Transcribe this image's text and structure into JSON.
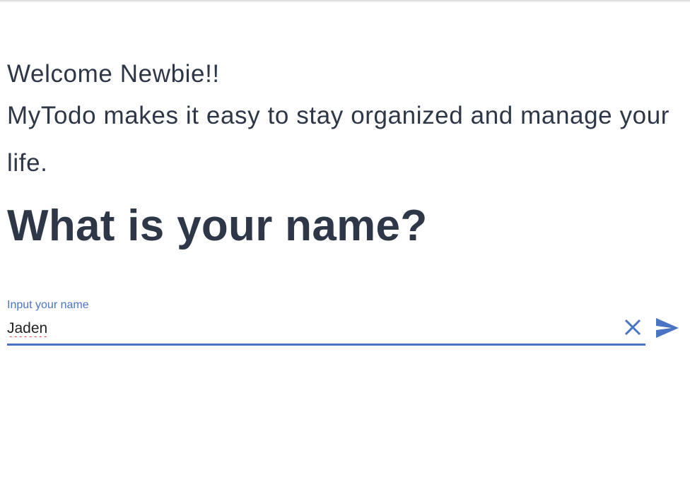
{
  "welcome": {
    "greeting": "Welcome Newbie!!",
    "tagline": "MyTodo makes it easy to stay organized and manage your life."
  },
  "prompt": {
    "question": "What is your name?"
  },
  "name_field": {
    "label": "Input your name",
    "value": "Jaden"
  },
  "icons": {
    "clear": "close-icon",
    "submit": "send-icon"
  },
  "colors": {
    "text": "#2d3748",
    "accent": "#4a74c4"
  }
}
